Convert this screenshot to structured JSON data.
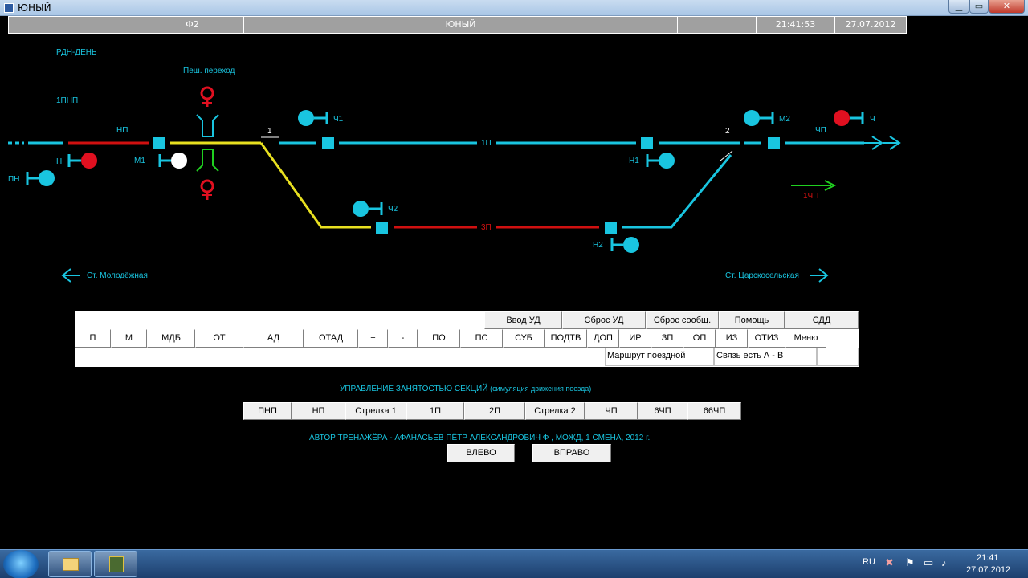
{
  "window": {
    "title": "ЮНЫЙ",
    "min_glyph": "▁",
    "max_glyph": "▭",
    "close_glyph": "✕"
  },
  "header": {
    "cells": [
      "",
      "Ф2",
      "ЮНЫЙ",
      "",
      "21:41:53",
      "27.07.2012"
    ]
  },
  "diagram": {
    "mode_label": "РДН-ДЕНЬ",
    "section_label": "1ПНП",
    "crossing_label": "Пеш. переход",
    "track_labels": {
      "np": "НП",
      "p1": "1П",
      "p3": "3П",
      "chp": "ЧП",
      "chp1": "1ЧП"
    },
    "switch_labels": {
      "s1": "1",
      "s2": "2"
    },
    "signals": {
      "n": "Н",
      "pn": "ПН",
      "m1": "М1",
      "ch1": "Ч1",
      "ch2": "Ч2",
      "n1": "Н1",
      "n2": "Н2",
      "m2": "М2",
      "ch": "Ч"
    },
    "stations": {
      "left": "Ст. Молодёжная",
      "right": "Ст. Царскосельская"
    },
    "colors": {
      "track": "#19c5e0",
      "occupied": "#d01010",
      "route": "#e8e020",
      "green": "#20d020"
    }
  },
  "panel": {
    "top_buttons": [
      "Ввод УД",
      "Сброс УД",
      "Сброс сообщ.",
      "Помощь",
      "СДД"
    ],
    "commands": [
      "П",
      "М",
      "МДБ",
      "ОТ",
      "АД",
      "ОТАД",
      "+",
      "-",
      "ПО",
      "ПС",
      "СУБ",
      "ПОДТВ",
      "ДОП",
      "ИР",
      "ЗП",
      "ОП",
      "ИЗ",
      "ОТИЗ",
      "Меню"
    ],
    "status": {
      "route": "Маршрут поездной",
      "link": "Связь есть А - В"
    }
  },
  "occupancy": {
    "title": "УПРАВЛЕНИЕ ЗАНЯТОСТЬЮ СЕКЦИЙ",
    "subtitle": "(симуляция движения поезда)",
    "buttons": [
      "ПНП",
      "НП",
      "Стрелка 1",
      "1П",
      "2П",
      "Стрелка 2",
      "ЧП",
      "6ЧП",
      "66ЧП"
    ]
  },
  "author": "АВТОР ТРЕНАЖЁРА - АФАНАСЬЕВ ПЁТР АЛЕКСАНДРОВИЧ Ф , МОЖД, 1 СМЕНА, 2012 г.",
  "nav": {
    "left": "ВЛЕВО",
    "right": "ВПРАВО"
  },
  "taskbar": {
    "lang": "RU",
    "time": "21:41",
    "date": "27.07.2012"
  }
}
